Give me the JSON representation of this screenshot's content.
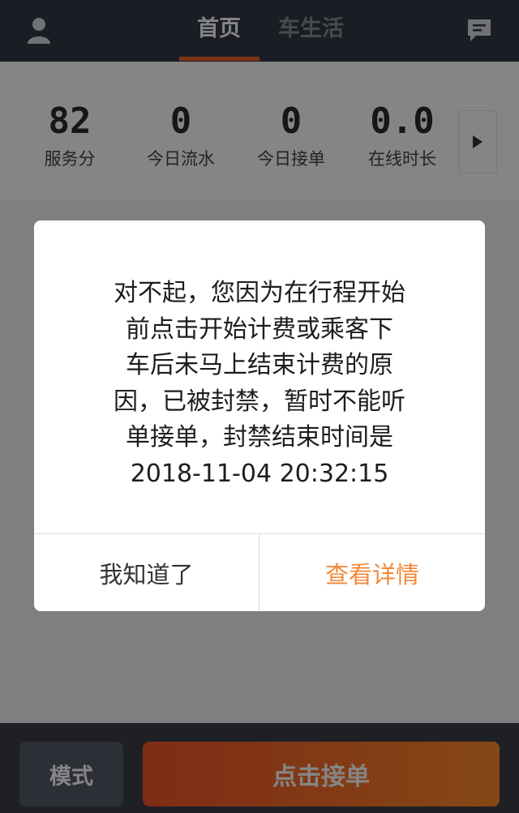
{
  "header": {
    "tabs": [
      {
        "label": "首页",
        "active": true
      },
      {
        "label": "车生活",
        "active": false
      }
    ],
    "left_icon": "user-icon",
    "right_icon": "message-icon"
  },
  "stats": [
    {
      "value": "82",
      "label": "服务分"
    },
    {
      "value": "0",
      "label": "今日流水"
    },
    {
      "value": "0",
      "label": "今日接单"
    },
    {
      "value": "0.0",
      "label": "在线时长"
    }
  ],
  "stats_more_icon": "play-arrow-icon",
  "dialog": {
    "lines": [
      "对不起，您因为在行程开始",
      "前点击开始计费或乘客下",
      "车后未马上结束计费的原",
      "因，已被封禁，暂时不能听",
      "单接单，封禁结束时间是",
      "2018-11-04 20:32:15"
    ],
    "ok_label": "我知道了",
    "detail_label": "查看详情"
  },
  "bottom_bar": {
    "mode_label": "模式",
    "accept_label": "点击接单"
  },
  "colors": {
    "header_bg": "#343845",
    "accent": "#f2652c",
    "detail_text": "#f2883a",
    "bottom_bg": "#3a3e4a"
  }
}
